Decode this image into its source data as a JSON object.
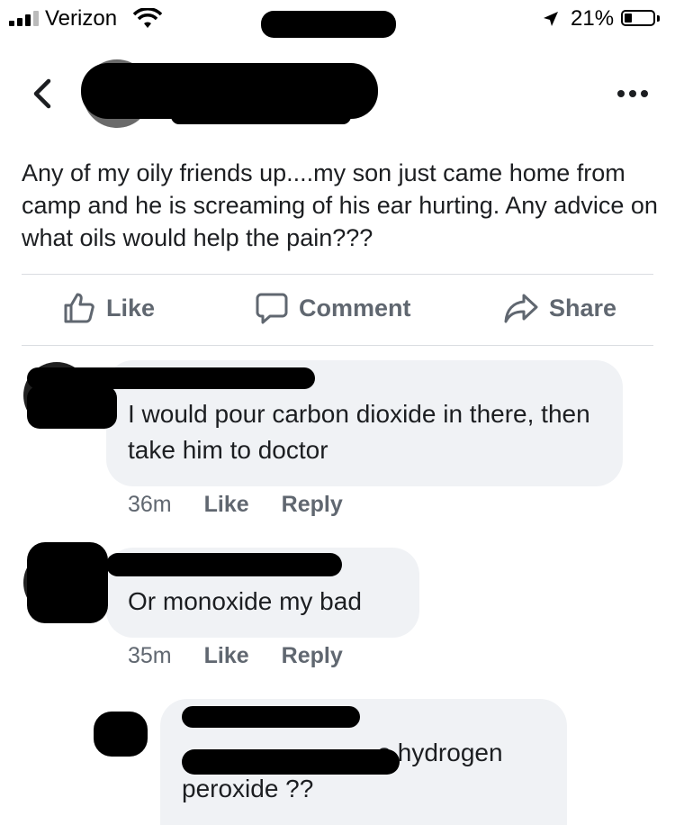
{
  "status_bar": {
    "carrier": "Verizon",
    "time": "",
    "battery_percent": "21%"
  },
  "header": {
    "author_name": "",
    "more_icon": "more-horizontal-icon",
    "back_icon": "chevron-left-icon"
  },
  "post": {
    "text": "Any of my oily friends up....my son just came home from camp and he is screaming of his ear hurting. Any advice on what oils would help the pain???"
  },
  "actions": {
    "like": "Like",
    "comment": "Comment",
    "share": "Share"
  },
  "comments": [
    {
      "author": "",
      "text": "I would pour carbon dioxide in there, then take him to doctor",
      "time": "36m",
      "like": "Like",
      "reply": "Reply"
    },
    {
      "author": "",
      "text": "Or monoxide my bad",
      "time": "35m",
      "like": "Like",
      "reply": "Reply"
    },
    {
      "author": "",
      "text": "s hydrogen peroxide ??"
    }
  ],
  "colors": {
    "text": "#1c1e21",
    "secondary": "#606770",
    "bubble": "#f0f2f5",
    "divider": "#dadde1"
  }
}
